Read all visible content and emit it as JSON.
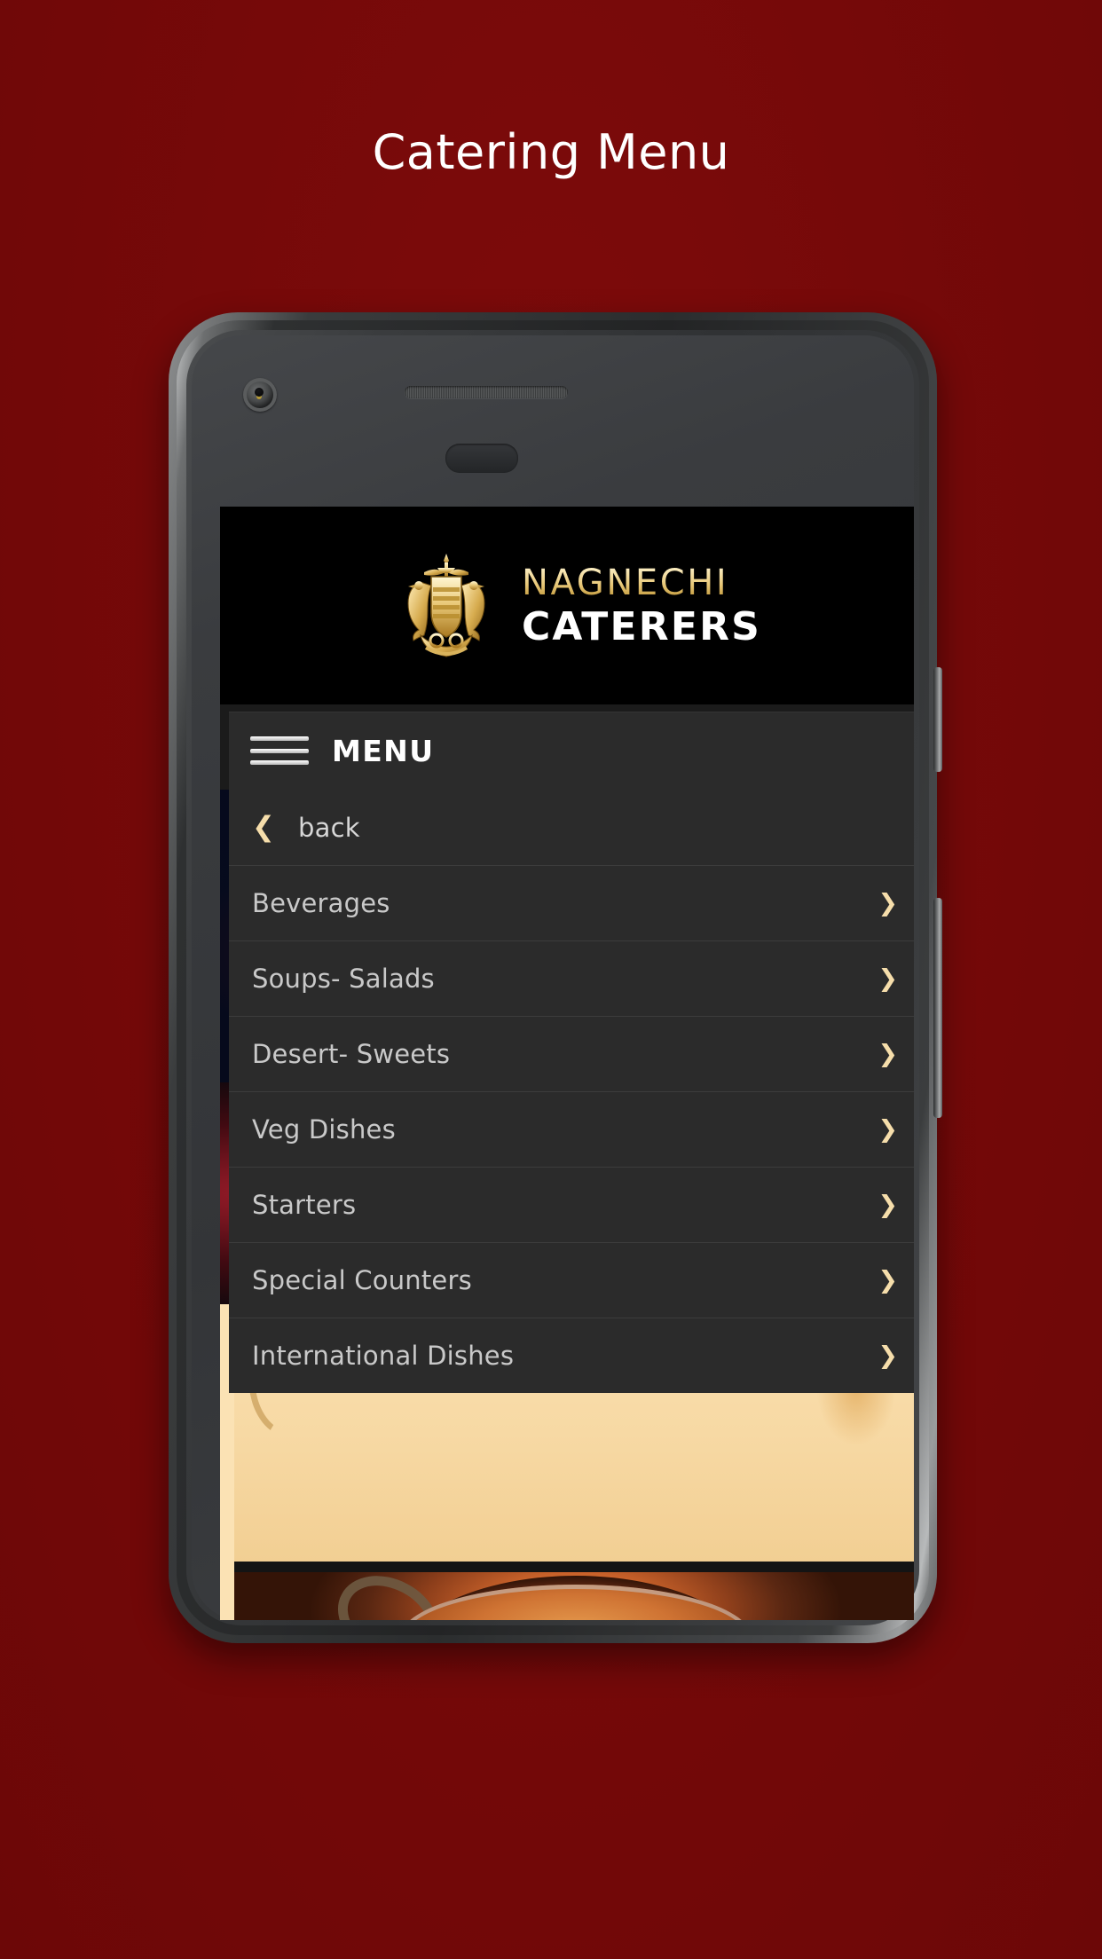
{
  "page": {
    "title": "Catering Menu",
    "background_color": "#7a0a0a",
    "title_color": "#ffffff"
  },
  "app": {
    "brand": {
      "line1": "NAGNECHI",
      "line2": "CATERERS",
      "line1_color": "#e8c878",
      "line2_color": "#ffffff",
      "crest_icon": "crest-emblem-icon"
    },
    "menu_bar": {
      "label": "MENU",
      "hamburger_icon": "hamburger-icon",
      "background_color": "#2b2b2b"
    },
    "dropdown": {
      "back": {
        "label": "back",
        "icon": "chevron-left-icon"
      },
      "chevron_icon": "chevron-right-icon",
      "accent_color": "#f6deab",
      "items": [
        {
          "label": "Beverages"
        },
        {
          "label": "Soups- Salads"
        },
        {
          "label": "Desert- Sweets"
        },
        {
          "label": "Veg Dishes"
        },
        {
          "label": "Starters"
        },
        {
          "label": "Special Counters"
        },
        {
          "label": "International Dishes"
        }
      ]
    },
    "hero_photo": {
      "alt": "curry-bowl-photo",
      "border_color": "#fbe2b4"
    },
    "cursor": {
      "icon": "crosshair-cursor-icon"
    }
  },
  "device": {
    "front_camera_icon": "front-camera-icon",
    "earpiece_icon": "earpiece-speaker-icon",
    "sensor_icon": "proximity-sensor-icon",
    "power_button": "power-button",
    "volume_button": "volume-rocker-button"
  }
}
